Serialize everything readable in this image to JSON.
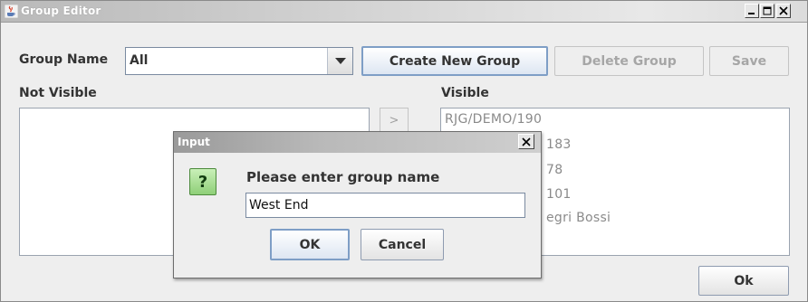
{
  "window": {
    "title": "Group Editor",
    "icon": "java-cup-icon"
  },
  "form": {
    "group_name_label": "Group Name",
    "group_name_value": "All",
    "create_button": "Create New Group",
    "delete_button": "Delete Group",
    "save_button": "Save"
  },
  "not_visible": {
    "label": "Not Visible",
    "items": []
  },
  "move_right_button": ">",
  "visible": {
    "label": "Visible",
    "items": [
      "RJG/DEMO/190",
      "183",
      "78",
      "101",
      "egri Bossi"
    ]
  },
  "ok_button": "Ok",
  "dialog": {
    "title": "Input",
    "icon": "question-icon",
    "icon_glyph": "?",
    "message": "Please enter group name",
    "input_value": "West End",
    "ok": "OK",
    "cancel": "Cancel"
  },
  "colors": {
    "accent_border": "#7e9ec6",
    "question_icon_green": "#8fcf78",
    "disabled_text": "#a6a6a6"
  }
}
